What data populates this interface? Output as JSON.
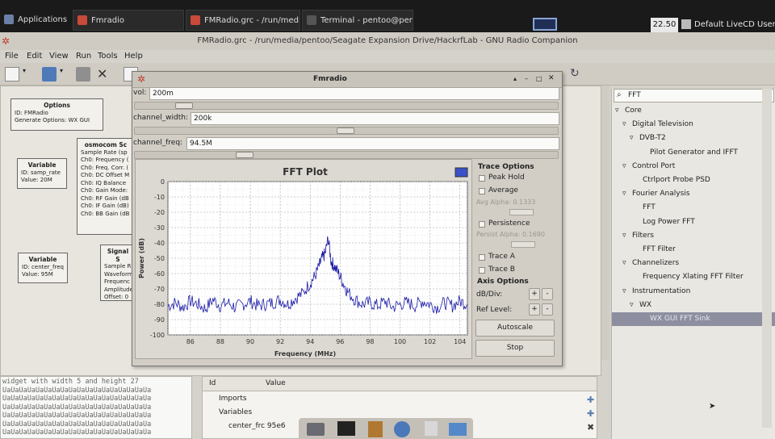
{
  "taskbar": {
    "applications": "Applications",
    "tasks": [
      "Fmradio",
      "FMRadio.grc - /run/medi",
      "Terminal - pentoo@pent"
    ],
    "clock": "22.50",
    "user": "Default LiveCD User"
  },
  "window": {
    "title": "FMRadio.grc - /run/media/pentoo/Seagate Expansion Drive/HackrfLab - GNU Radio Companion"
  },
  "menu": [
    "File",
    "Edit",
    "View",
    "Run",
    "Tools",
    "Help"
  ],
  "blocks": {
    "options": {
      "title": "Options",
      "lines": [
        "ID: FMRadio",
        "Generate Options: WX GUI"
      ]
    },
    "var1": {
      "title": "Variable",
      "lines": [
        "ID: samp_rate",
        "Value: 20M"
      ]
    },
    "var2": {
      "title": "Variable",
      "lines": [
        "ID: center_freq",
        "Value: 95M"
      ]
    },
    "osmo": {
      "title": "osmocom Sc",
      "lines": [
        "Sample Rate (sp",
        "Ch0: Frequency (",
        "Ch0: Freq. Corr. (",
        "Ch0: DC Offset M",
        "Ch0: IQ Balance",
        "Ch0: Gain Mode:",
        "Ch0: RF Gain (dB",
        "Ch0: IF Gain (dB)",
        "Ch0: BB Gain (dB"
      ]
    },
    "signal": {
      "title": "Signal S",
      "lines": [
        "Sample R",
        "Waveform",
        "Frequenc",
        "Amplitude",
        "Offset: 0"
      ]
    }
  },
  "console": {
    "header": "widget with width  5 and height 27",
    "line": "UaUaUaUaUaUaUaUaUaUaUaUaUaUaUaUaUaUa"
  },
  "variables": {
    "col_id": "Id",
    "col_value": "Value",
    "rows": [
      "Imports",
      "Variables",
      "center_frc 95e6"
    ]
  },
  "tree": {
    "search": "FFT",
    "items": [
      {
        "label": "Core",
        "indent": 0,
        "arrow": "▿"
      },
      {
        "label": "Digital Television",
        "indent": 1,
        "arrow": "▿"
      },
      {
        "label": "DVB-T2",
        "indent": 2,
        "arrow": "▿"
      },
      {
        "label": "Pilot Generator and IFFT",
        "indent": 3,
        "arrow": ""
      },
      {
        "label": "Control Port",
        "indent": 1,
        "arrow": "▿"
      },
      {
        "label": "Ctrlport Probe PSD",
        "indent": 2,
        "arrow": ""
      },
      {
        "label": "Fourier Analysis",
        "indent": 1,
        "arrow": "▿"
      },
      {
        "label": "FFT",
        "indent": 2,
        "arrow": ""
      },
      {
        "label": "Log Power FFT",
        "indent": 2,
        "arrow": ""
      },
      {
        "label": "Filters",
        "indent": 1,
        "arrow": "▿"
      },
      {
        "label": "FFT Filter",
        "indent": 2,
        "arrow": ""
      },
      {
        "label": "Channelizers",
        "indent": 1,
        "arrow": "▿"
      },
      {
        "label": "Frequency Xlating FFT Filter",
        "indent": 2,
        "arrow": ""
      },
      {
        "label": "Instrumentation",
        "indent": 1,
        "arrow": "▿"
      },
      {
        "label": "WX",
        "indent": 2,
        "arrow": "▿"
      },
      {
        "label": "WX GUI FFT Sink",
        "indent": 3,
        "arrow": "",
        "selected": true
      }
    ]
  },
  "fmradio": {
    "title": "Fmradio",
    "vol_label": "vol:",
    "vol_value": "200m",
    "vol_level": 0.1,
    "cw_label": "channel_width:",
    "cw_value": "200k",
    "cw_level": 0.5,
    "cf_label": "channel_freq:",
    "cf_value": "94.5M",
    "cf_level": 0.25,
    "trace_options": "Trace Options",
    "peak_hold": "Peak Hold",
    "average": "Average",
    "avg_alpha": "Avg Alpha:  0.1333",
    "persistence": "Persistence",
    "persist_alpha": "Persist Alpha:  0.1690",
    "trace_a": "Trace A",
    "trace_b": "Trace B",
    "axis_options": "Axis Options",
    "db_div": "dB/Div:",
    "ref_level": "Ref Level:",
    "autoscale": "Autoscale",
    "stop": "Stop",
    "plus": "+",
    "minus": "-"
  },
  "chart_data": {
    "type": "line",
    "title": "FFT Plot",
    "xlabel": "Frequency (MHz)",
    "ylabel": "Power (dB)",
    "xlim": [
      84.5,
      104.5
    ],
    "ylim": [
      -100,
      0
    ],
    "xticks": [
      86,
      88,
      90,
      92,
      94,
      96,
      98,
      100,
      102,
      104
    ],
    "yticks": [
      0,
      -10,
      -20,
      -30,
      -40,
      -50,
      -60,
      -70,
      -80,
      -90,
      -100
    ],
    "grid": true,
    "series": [
      {
        "color": "#1a1aa8",
        "noise_floor": -80,
        "peak_x": 95.2,
        "peak_y": -37,
        "x": [
          84.5,
          85,
          85.5,
          86,
          86.5,
          87,
          87.5,
          88,
          88.5,
          89,
          89.5,
          90,
          90.5,
          91,
          91.5,
          92,
          92.5,
          93,
          93.5,
          94,
          94.3,
          94.6,
          94.8,
          95,
          95.2,
          95.4,
          95.6,
          95.9,
          96.2,
          96.5,
          97,
          97.5,
          98,
          98.5,
          99,
          99.5,
          100,
          100.5,
          101,
          101.5,
          102,
          102.5,
          103,
          103.5,
          104,
          104.5
        ],
        "y": [
          -81,
          -79,
          -82,
          -78,
          -80,
          -83,
          -77,
          -81,
          -79,
          -82,
          -80,
          -78,
          -81,
          -80,
          -79,
          -77,
          -80,
          -76,
          -73,
          -66,
          -62,
          -55,
          -50,
          -47,
          -37,
          -52,
          -55,
          -60,
          -66,
          -72,
          -77,
          -80,
          -79,
          -81,
          -78,
          -82,
          -80,
          -79,
          -81,
          -78,
          -80,
          -82,
          -79,
          -81,
          -78,
          -80
        ]
      }
    ]
  }
}
